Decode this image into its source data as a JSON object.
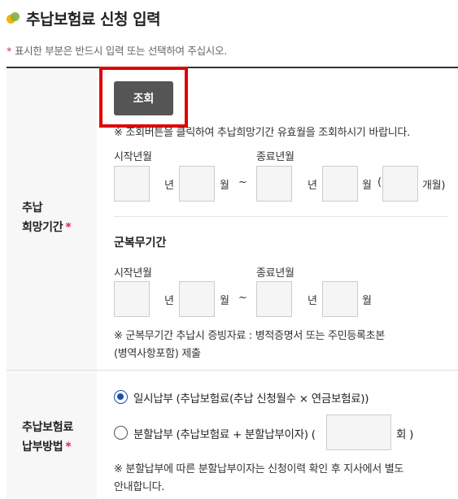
{
  "header": {
    "title": "추납보험료 신청 입력"
  },
  "notice": {
    "star": "*",
    "text": "표시한 부분은 반드시 입력 또는 선택하여 주십시오."
  },
  "period_row": {
    "label_line1": "추납",
    "label_line2": "희망기간",
    "required": "*",
    "lookup_button": "조회",
    "lookup_hint": "※ 조회버튼을 클릭하여 추납희망기간 유효월을 조회하시기 바랍니다.",
    "start_label": "시작년월",
    "end_label": "종료년월",
    "year_unit": "년",
    "month_unit": "월",
    "tilde": "~",
    "count_open": "(",
    "count_unit": "개월)",
    "military_title": "군복무기간",
    "military_start_label": "시작년월",
    "military_end_label": "종료년월",
    "military_note_line1": "※ 군복무기간 추납시 증빙자료 : 병적증명서 또는 주민등록초본",
    "military_note_line2": "(병역사항포함) 제출"
  },
  "payment_row": {
    "label_line1": "추납보험료",
    "label_line2": "납부방법",
    "required": "*",
    "option_lump": "일시납부 (추납보험료(추납 신청월수 × 연금보험료))",
    "option_lump_selected": true,
    "option_installment": "분할납부 (추납보험료 + 분할납부이자) (",
    "installment_unit": "회 )",
    "note_line1": "※ 분할납부에 따른 분할납부이자는 신청이력 확인 후 지사에서 별도",
    "note_line2": "안내합니다."
  }
}
